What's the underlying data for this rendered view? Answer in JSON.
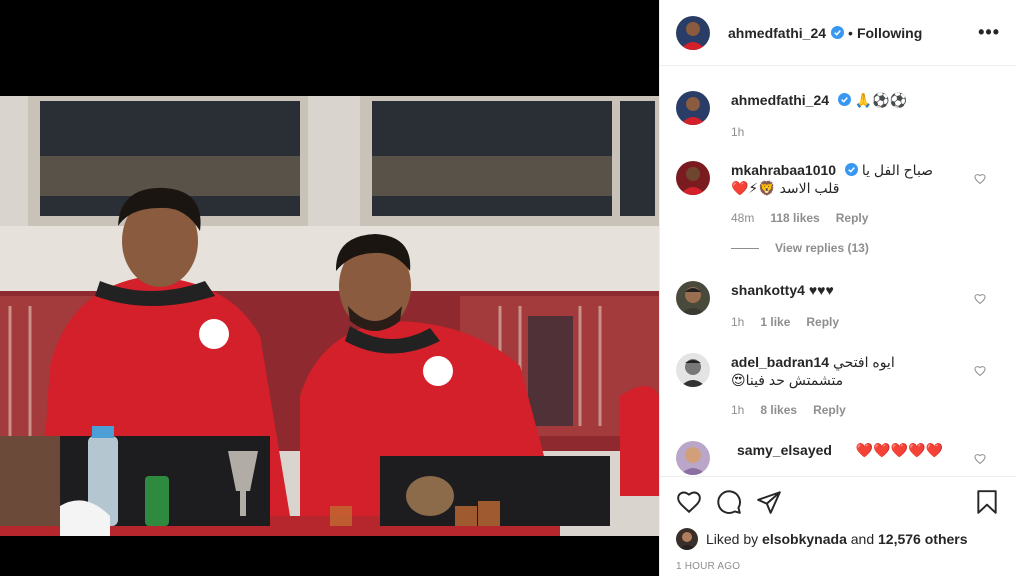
{
  "header": {
    "username": "ahmedfathi_24",
    "separator": "•",
    "follow_state": "Following",
    "more": "•••"
  },
  "caption": {
    "username": "ahmedfathi_24",
    "text": "🙏⚽⚽",
    "time": "1h"
  },
  "comments": [
    {
      "username": "mkahrabaa1010",
      "verified": true,
      "text_line1": "صباح الفل يا",
      "text_line2": "قلب الاسد 🦁⚡❤️",
      "time": "48m",
      "likes": "118 likes",
      "reply": "Reply",
      "view_replies": "View replies (13)"
    },
    {
      "username": "shankotty4",
      "text_line1": "♥♥♥",
      "time": "1h",
      "likes": "1 like",
      "reply": "Reply"
    },
    {
      "username": "adel_badran14",
      "text_line1": "ايوه افتحي",
      "text_line2": "متشمتش حد فينا😍",
      "time": "1h",
      "likes": "8 likes",
      "reply": "Reply"
    },
    {
      "username": "samy_elsayed",
      "text_line1": "❤️❤️❤️❤️❤️"
    }
  ],
  "liked_by": {
    "prefix": "Liked by",
    "user": "elsobkynada",
    "conjunction": "and",
    "others": "12,576 others"
  },
  "post_time": "1 HOUR AGO",
  "colors": {
    "verified_blue": "#3897f0",
    "jersey_red": "#d3202a",
    "muted_text": "#8e8e8e"
  }
}
